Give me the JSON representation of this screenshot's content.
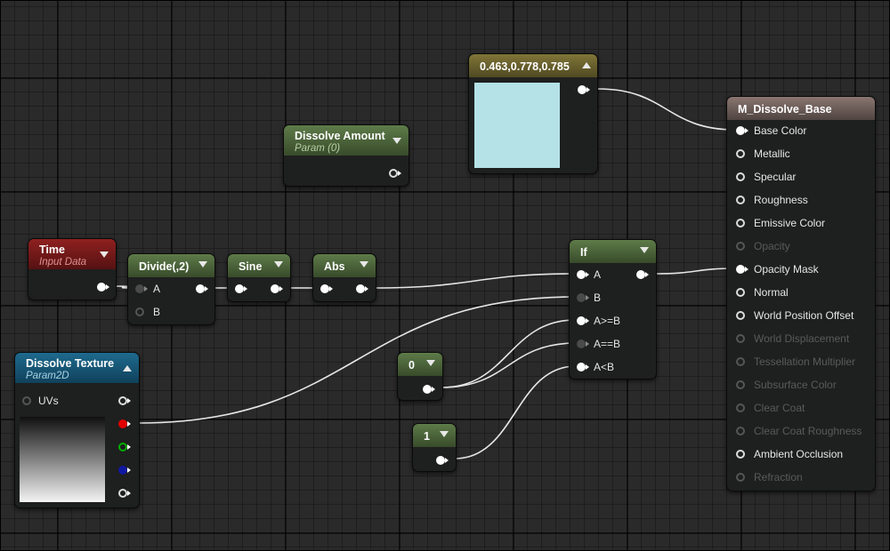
{
  "colors": {
    "canvas": "#2a2a2a",
    "node_body": "#1e1f1f",
    "wire": "#e6e6e6",
    "const_vec3_preview": "#b4e2e6",
    "pin_red": "#e00000",
    "pin_green": "#00b000",
    "pin_blue": "#1018a0"
  },
  "nodes": {
    "const_vec3": {
      "title": "0.463,0.778,0.785",
      "color": [
        0.463,
        0.778,
        0.785
      ]
    },
    "dissolve_amount": {
      "title": "Dissolve Amount",
      "subtitle": "Param (0)"
    },
    "time": {
      "title": "Time",
      "subtitle": "Input Data"
    },
    "divide": {
      "title": "Divide(,2)",
      "pin_a": "A",
      "pin_b": "B"
    },
    "sine": {
      "title": "Sine"
    },
    "abs": {
      "title": "Abs"
    },
    "if_node": {
      "title": "If",
      "pins": [
        "A",
        "B",
        "A>=B",
        "A==B",
        "A<B"
      ]
    },
    "const_0": {
      "title": "0"
    },
    "const_1": {
      "title": "1"
    },
    "dissolve_texture": {
      "title": "Dissolve Texture",
      "subtitle": "Param2D",
      "pin_uvs": "UVs"
    },
    "material": {
      "title": "M_Dissolve_Base",
      "inputs": [
        {
          "label": "Base Color",
          "state": "connected"
        },
        {
          "label": "Metallic",
          "state": "enabled"
        },
        {
          "label": "Specular",
          "state": "enabled"
        },
        {
          "label": "Roughness",
          "state": "enabled"
        },
        {
          "label": "Emissive Color",
          "state": "enabled"
        },
        {
          "label": "Opacity",
          "state": "disabled"
        },
        {
          "label": "Opacity Mask",
          "state": "connected"
        },
        {
          "label": "Normal",
          "state": "enabled"
        },
        {
          "label": "World Position Offset",
          "state": "enabled"
        },
        {
          "label": "World Displacement",
          "state": "disabled"
        },
        {
          "label": "Tessellation Multiplier",
          "state": "disabled"
        },
        {
          "label": "Subsurface Color",
          "state": "disabled"
        },
        {
          "label": "Clear Coat",
          "state": "disabled"
        },
        {
          "label": "Clear Coat Roughness",
          "state": "disabled"
        },
        {
          "label": "Ambient Occlusion",
          "state": "enabled"
        },
        {
          "label": "Refraction",
          "state": "disabled"
        }
      ]
    }
  }
}
